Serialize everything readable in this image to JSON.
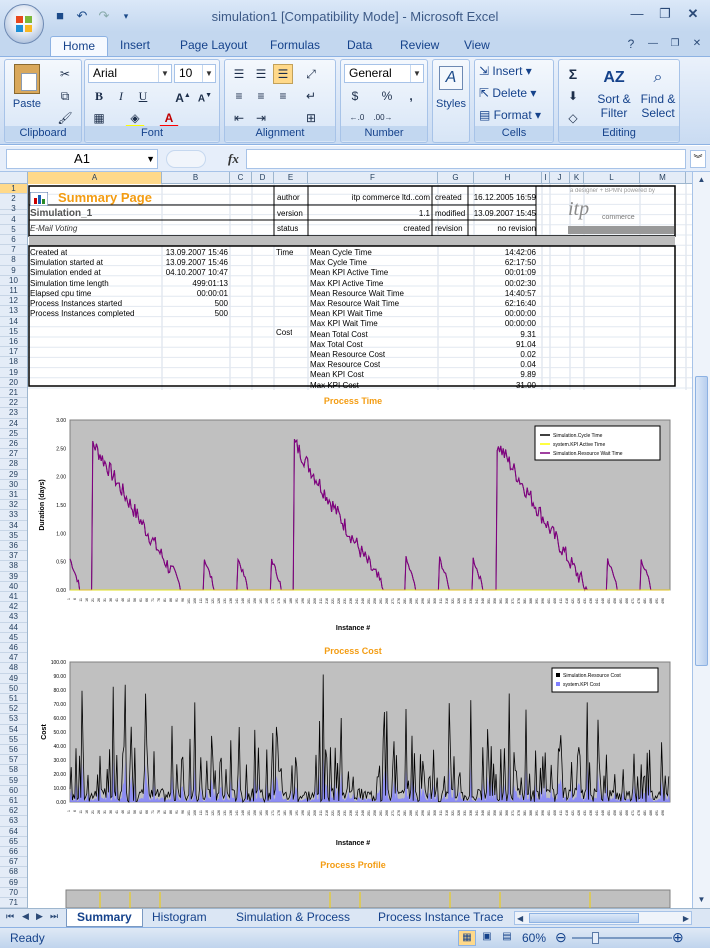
{
  "window": {
    "title": "simulation1  [Compatibility Mode] - Microsoft Excel"
  },
  "ribbon_tabs": [
    "Home",
    "Insert",
    "Page Layout",
    "Formulas",
    "Data",
    "Review",
    "View"
  ],
  "ribbon": {
    "clipboard": {
      "label": "Clipboard",
      "paste": "Paste"
    },
    "font": {
      "label": "Font",
      "name": "Arial",
      "size": "10",
      "bold": "B",
      "italic": "I",
      "underline": "U"
    },
    "alignment": {
      "label": "Alignment"
    },
    "number": {
      "label": "Number",
      "format": "General",
      "percent": "%",
      "comma": ","
    },
    "styles": {
      "label": "Styles"
    },
    "cells": {
      "label": "Cells",
      "insert": "Insert",
      "delete": "Delete",
      "format": "Format"
    },
    "editing": {
      "label": "Editing",
      "sort": "Sort &",
      "filter": "Filter",
      "find": "Find &",
      "select": "Select"
    }
  },
  "formula_bar": {
    "name_box": "A1",
    "fx": "fx",
    "content": ""
  },
  "columns": [
    "A",
    "B",
    "C",
    "D",
    "E",
    "F",
    "G",
    "H",
    "I",
    "J",
    "K",
    "L",
    "M"
  ],
  "rows": [
    "1",
    "2",
    "3",
    "4",
    "5",
    "6",
    "7",
    "8",
    "9",
    "10",
    "11",
    "12",
    "13",
    "14",
    "15",
    "16",
    "17",
    "18",
    "19",
    "20",
    "21",
    "22",
    "23",
    "24",
    "25",
    "26",
    "27",
    "28",
    "29",
    "30",
    "31",
    "32",
    "33",
    "34",
    "35",
    "36",
    "37",
    "38",
    "39",
    "40",
    "41",
    "42",
    "43",
    "44",
    "45",
    "46",
    "47",
    "48",
    "49",
    "50",
    "51",
    "52",
    "53",
    "54",
    "55",
    "56",
    "57",
    "58",
    "59",
    "60",
    "61",
    "62",
    "63",
    "64",
    "65",
    "66",
    "67",
    "68",
    "69",
    "70",
    "71"
  ],
  "summary": {
    "title": "Summary Page",
    "sim_name": "Simulation_1",
    "model": "E-Mail Voting",
    "author_label": "author",
    "author": "itp commerce ltd..com",
    "created_label": "created",
    "created": "16.12.2005 16:59",
    "version_label": "version",
    "version": "1.1",
    "modified_label": "modified",
    "modified": "13.09.2007 15:45",
    "status_label": "status",
    "status": "created",
    "revision_label": "revision",
    "revision": "no revision",
    "logo_small": "a designer + BPMN powered by",
    "logo": "itp",
    "logo_sub": "commerce"
  },
  "info_rows": [
    {
      "label": "Created at",
      "value": "13.09.2007 15:46"
    },
    {
      "label": "Simulation started at",
      "value": "13.09.2007 15:46"
    },
    {
      "label": "Simulation ended at",
      "value": "04.10.2007 10:47"
    },
    {
      "label": "Simulation time length",
      "value": "499:01:13"
    },
    {
      "label": "Elapsed cpu time",
      "value": "00:00:01"
    },
    {
      "label": "Process Instances started",
      "value": "500"
    },
    {
      "label": "Process Instances completed",
      "value": "500"
    }
  ],
  "time_label": "Time",
  "cost_label": "Cost",
  "metrics": [
    {
      "label": "Mean Cycle Time",
      "value": "14:42:06"
    },
    {
      "label": "Max Cycle Time",
      "value": "62:17:50"
    },
    {
      "label": "Mean KPI Active Time",
      "value": "00:01:09"
    },
    {
      "label": "Max KPI Active Time",
      "value": "00:02:30"
    },
    {
      "label": "Mean Resource Wait Time",
      "value": "14:40:57"
    },
    {
      "label": "Max Resource Wait Time",
      "value": "62:16:40"
    },
    {
      "label": "Mean KPI Wait Time",
      "value": "00:00:00"
    },
    {
      "label": "Max KPI Wait Time",
      "value": "00:00:00"
    },
    {
      "label": "Mean Total Cost",
      "value": "9.31"
    },
    {
      "label": "Max Total Cost",
      "value": "91.04"
    },
    {
      "label": "Mean Resource Cost",
      "value": "0.02"
    },
    {
      "label": "Max Resource Cost",
      "value": "0.04"
    },
    {
      "label": "Mean KPI Cost",
      "value": "9.89"
    },
    {
      "label": "Max KPI Cost",
      "value": "31.00"
    }
  ],
  "chart_data": [
    {
      "type": "line",
      "title": "Process Time",
      "xlabel": "Instance #",
      "ylabel": "Duration (days)",
      "ylim": [
        0,
        3
      ],
      "yticks": [
        "0.00",
        "0.50",
        "1.00",
        "1.50",
        "2.00",
        "2.50",
        "3.00"
      ],
      "grid": false,
      "legend_position": "top-right",
      "series": [
        {
          "name": "Simulation.Cycle Time",
          "color": "#000000"
        },
        {
          "name": "system.KPI Active Time",
          "color": "#ffff00"
        },
        {
          "name": "Simulation.Resource Wait Time",
          "color": "#800080"
        }
      ],
      "peaks": [
        {
          "x": 19,
          "y": 2.6
        },
        {
          "x": 187,
          "y": 2.6
        },
        {
          "x": 356,
          "y": 2.6
        }
      ],
      "x_max": 500
    },
    {
      "type": "area",
      "title": "Process Cost",
      "xlabel": "Instance #",
      "ylabel": "Cost",
      "ylim": [
        0,
        100
      ],
      "yticks": [
        "0.00",
        "10.00",
        "20.00",
        "30.00",
        "40.00",
        "50.00",
        "60.00",
        "70.00",
        "80.00",
        "90.00",
        "100.00"
      ],
      "grid": false,
      "legend_position": "top-right",
      "series": [
        {
          "name": "Simulation.Resource Cost",
          "color": "#000000"
        },
        {
          "name": "system.KPI Cost",
          "color": "#8080ff"
        }
      ],
      "max_value": 91.04,
      "x_max": 500
    },
    {
      "type": "bar",
      "title": "Process Profile"
    }
  ],
  "sheet_tabs": [
    "Summary",
    "Histogram",
    "Simulation & Process",
    "Process Instance Trace"
  ],
  "status": {
    "ready": "Ready",
    "zoom": "60%"
  }
}
